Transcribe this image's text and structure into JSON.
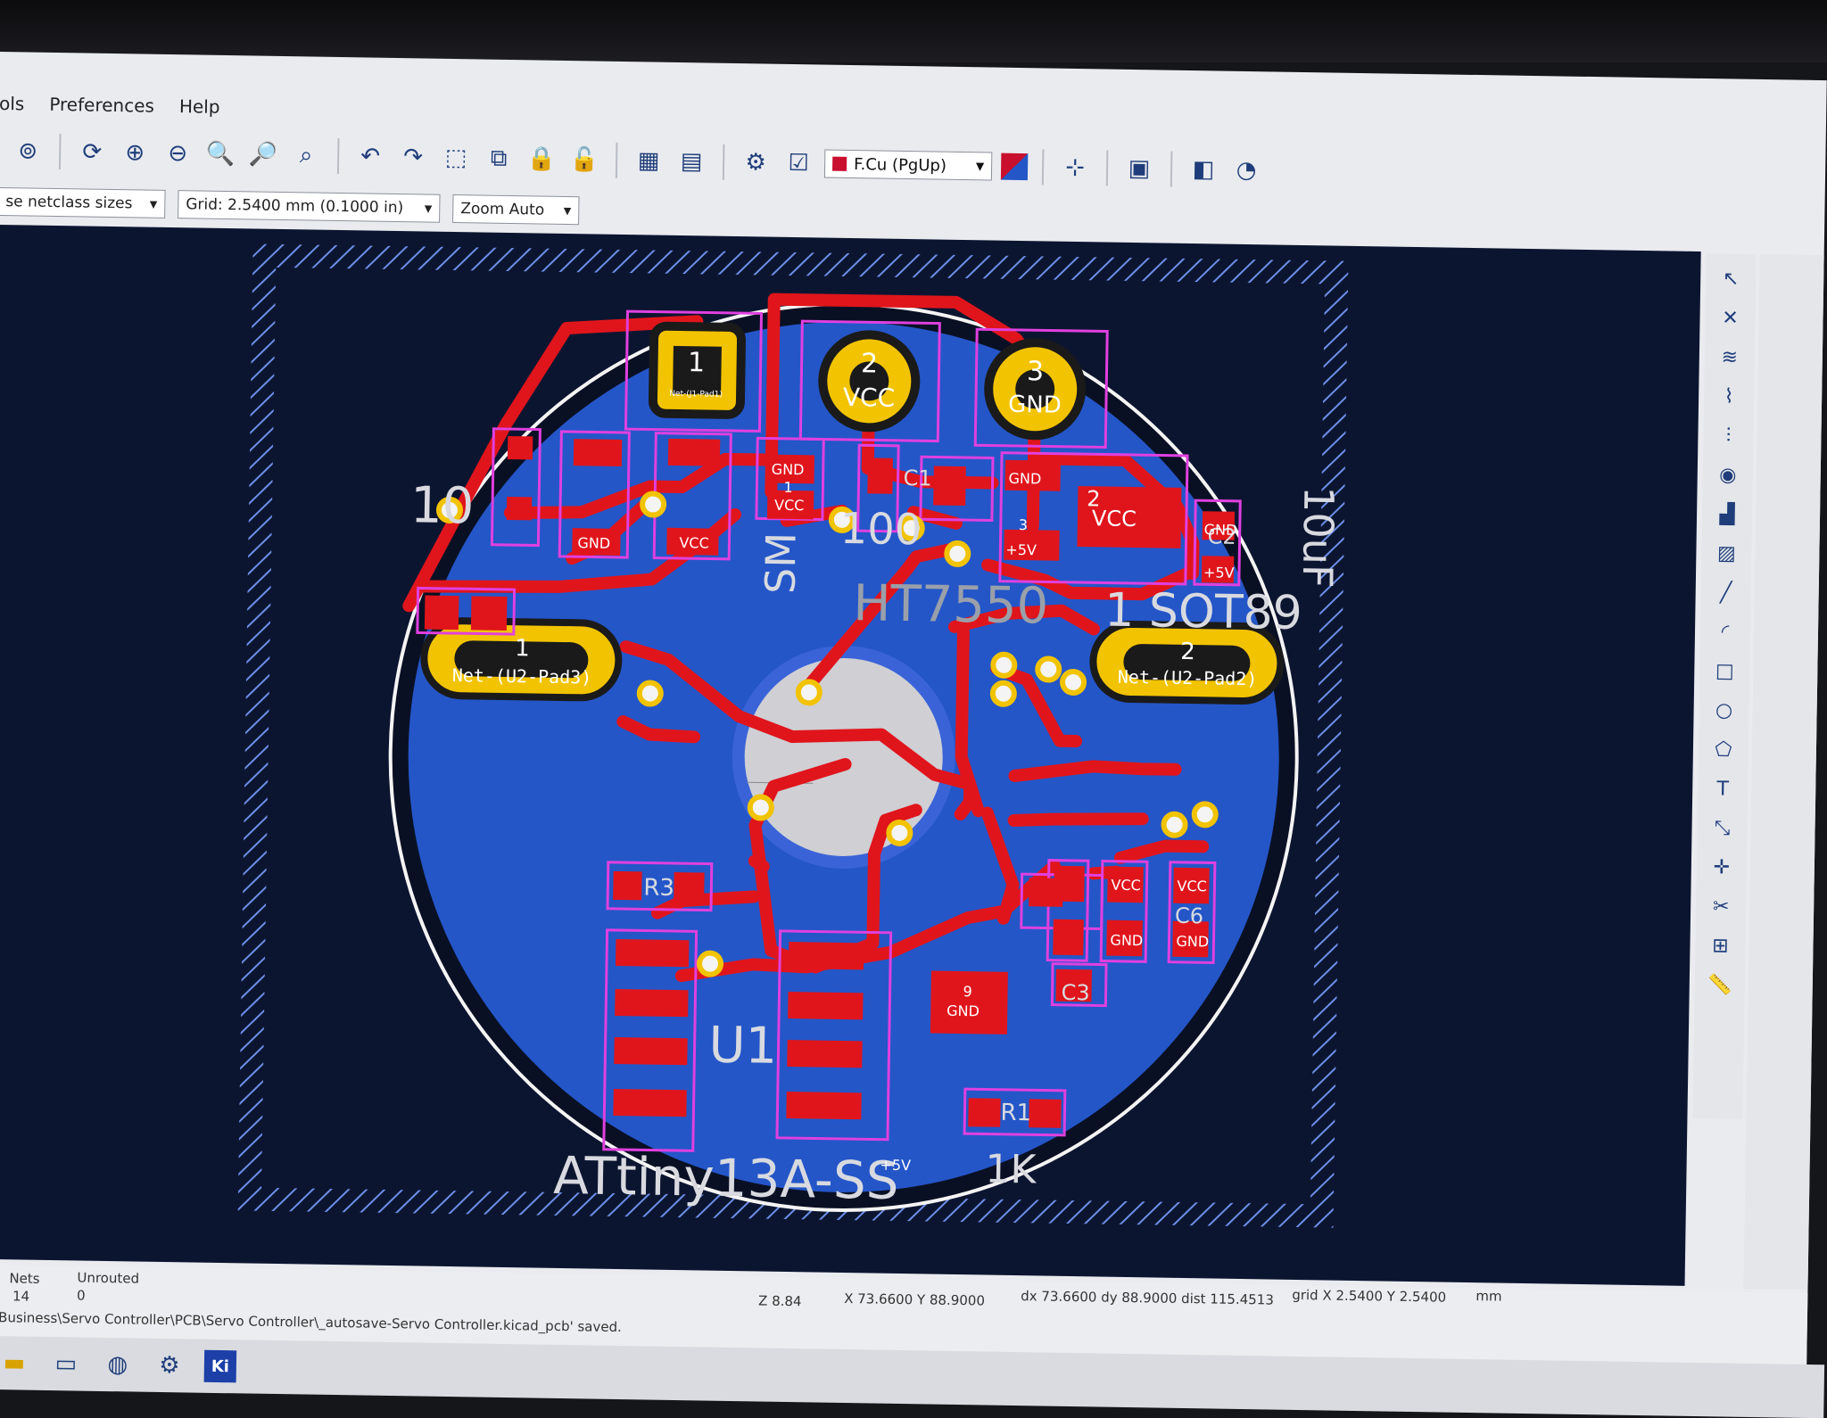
{
  "menu": {
    "items": [
      "ols",
      "Preferences",
      "Help"
    ]
  },
  "toolbar": {
    "layer_select": "F.Cu (PgUp)",
    "netclass": "se netclass sizes",
    "grid": "Grid: 2.5400 mm (0.1000 in)",
    "zoom": "Zoom Auto"
  },
  "board": {
    "pads": {
      "p1": {
        "num": "1",
        "net": "Net-(J1-Pad1)"
      },
      "vcc": {
        "num": "2",
        "net": "VCC"
      },
      "gnd": {
        "num": "3",
        "net": "GND"
      },
      "left_oval": {
        "num": "1",
        "net": "Net-(U2-Pad3)"
      },
      "right_oval": {
        "num": "2",
        "net": "Net-(U2-Pad2)"
      }
    },
    "labels": {
      "sot89": "1 SOT89",
      "cap10uf": "10uF",
      "ht": "HT7550",
      "sm": "SM",
      "attiny": "ATtiny13A-SS",
      "u1": "U1",
      "r1": "R1",
      "r3": "R3",
      "c1": "C1",
      "c2": "C2",
      "c3": "C3",
      "c6": "C6",
      "val100": "100",
      "val1k": "1K",
      "val10": "10",
      "gnd": "GND",
      "vcc": "VCC",
      "p5v": "+5V",
      "n1": "1",
      "n2": "2",
      "n3": "3",
      "n9": "9"
    }
  },
  "status": {
    "nets_label": "Nets",
    "nets_value": "14",
    "unrouted_label": "Unrouted",
    "unrouted_value": "0",
    "message": "ss Business\\Servo Controller\\PCB\\Servo Controller\\_autosave-Servo Controller.kicad_pcb' saved.",
    "zoom": "Z 8.84",
    "xy": "X 73.6600  Y 88.9000",
    "delta": "dx 73.6600  dy 88.9000  dist 115.4513",
    "grid": "grid X 2.5400  Y 2.5400",
    "units": "mm"
  },
  "taskbar": {
    "kicad_label": "Ki"
  },
  "colors": {
    "copper_front": "#e0151c",
    "fill_blue": "#2456c8",
    "pad_gold": "#f2c300",
    "courtyard": "#e040e0",
    "background": "#0c1530"
  }
}
